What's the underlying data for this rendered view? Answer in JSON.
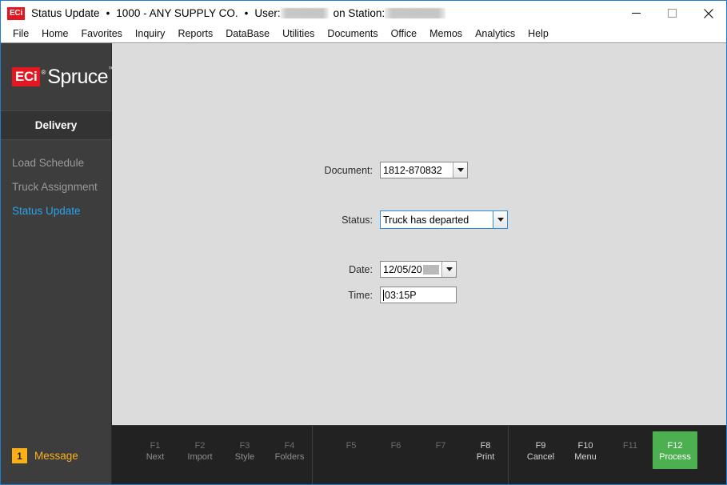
{
  "titlebar": {
    "app_icon": "eci-logo",
    "title": "Status Update",
    "separator": "•",
    "company": "1000 - ANY SUPPLY CO.",
    "user_label": "User:",
    "user_value": "",
    "station_prefix": "on Station:",
    "station_value": "",
    "minimize": "minimize-icon",
    "maximize": "maximize-icon",
    "close": "close-icon"
  },
  "menubar": {
    "items": [
      {
        "label": "File"
      },
      {
        "label": "Home"
      },
      {
        "label": "Favorites"
      },
      {
        "label": "Inquiry"
      },
      {
        "label": "Reports"
      },
      {
        "label": "DataBase"
      },
      {
        "label": "Utilities"
      },
      {
        "label": "Documents"
      },
      {
        "label": "Office"
      },
      {
        "label": "Memos"
      },
      {
        "label": "Analytics"
      },
      {
        "label": "Help"
      }
    ]
  },
  "sidebar": {
    "brand": {
      "eci": "ECi",
      "registered": "®",
      "product": "Spruce",
      "trademark": "™"
    },
    "group_header": "Delivery",
    "items": [
      {
        "label": "Load Schedule",
        "active": false
      },
      {
        "label": "Truck Assignment",
        "active": false
      },
      {
        "label": "Status Update",
        "active": true
      }
    ],
    "message": {
      "count": "1",
      "label": "Message",
      "badge_color": "#fbb018"
    }
  },
  "form": {
    "document": {
      "label": "Document:",
      "value": "1812-870832",
      "focused": false
    },
    "status": {
      "label": "Status:",
      "value": "Truck has departed",
      "focused": true
    },
    "date": {
      "label": "Date:",
      "value": "12/05/20",
      "redacted_suffix": true,
      "focused": false
    },
    "time": {
      "label": "Time:",
      "value": "03:15P",
      "focused": true
    }
  },
  "function_bar": {
    "groups": [
      {
        "keys": [
          {
            "num": "F1",
            "action": "Next",
            "enabled": false
          },
          {
            "num": "F2",
            "action": "Import",
            "enabled": false
          },
          {
            "num": "F3",
            "action": "Style",
            "enabled": false
          },
          {
            "num": "F4",
            "action": "Folders",
            "enabled": false
          }
        ]
      },
      {
        "keys": [
          {
            "num": "F5",
            "action": "",
            "enabled": false
          },
          {
            "num": "F6",
            "action": "",
            "enabled": false
          },
          {
            "num": "F7",
            "action": "",
            "enabled": false
          },
          {
            "num": "F8",
            "action": "Print",
            "enabled": true
          }
        ]
      },
      {
        "keys": [
          {
            "num": "F9",
            "action": "Cancel",
            "enabled": true
          },
          {
            "num": "F10",
            "action": "Menu",
            "enabled": true
          },
          {
            "num": "F11",
            "action": "",
            "enabled": false
          },
          {
            "num": "F12",
            "action": "Process",
            "enabled": true,
            "primary": true,
            "color": "#4caf50"
          }
        ]
      }
    ]
  },
  "colors": {
    "accent_blue": "#1a7fd4",
    "active_nav": "#2aa3e8",
    "brand_red": "#e4161f",
    "content_bg": "#dcdcdc",
    "sidebar_bg": "#3d3d3d",
    "fbar_bg": "#222222",
    "process_green": "#4caf50",
    "message_amber": "#fbb018"
  }
}
